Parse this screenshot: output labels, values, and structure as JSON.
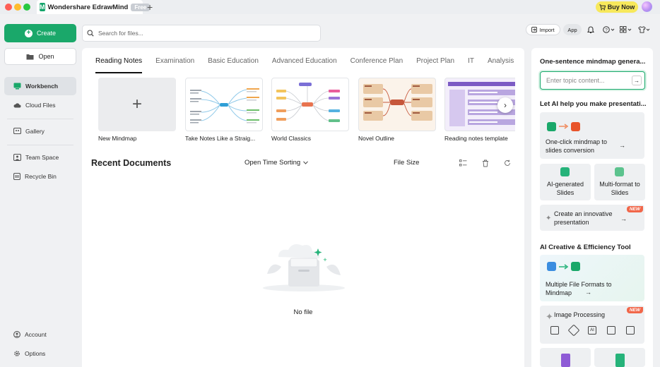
{
  "window": {
    "app_name": "Wondershare EdrawMind",
    "plan_badge": "Free",
    "new_tab": "+",
    "buy_now": "Buy Now"
  },
  "sidebar": {
    "create_label": "Create",
    "open_label": "Open",
    "items": [
      {
        "label": "Workbench",
        "icon": "workbench-icon",
        "active": true
      },
      {
        "label": "Cloud Files",
        "icon": "cloud-icon"
      },
      {
        "label": "Gallery",
        "icon": "gallery-icon"
      },
      {
        "label": "Team Space",
        "icon": "team-icon"
      },
      {
        "label": "Recycle Bin",
        "icon": "trash-icon"
      }
    ],
    "bottom": [
      {
        "label": "Account",
        "icon": "account-icon"
      },
      {
        "label": "Options",
        "icon": "gear-icon"
      }
    ]
  },
  "search": {
    "placeholder": "Search for files..."
  },
  "toolbar": {
    "import_label": "Import",
    "app_label": "App"
  },
  "tabs": [
    "Reading Notes",
    "Examination",
    "Basic Education",
    "Advanced Education",
    "Conference Plan",
    "Project Plan",
    "IT",
    "Analysis"
  ],
  "templates": [
    {
      "label": "New Mindmap"
    },
    {
      "label": "Take Notes Like a Straig..."
    },
    {
      "label": "World Classics"
    },
    {
      "label": "Novel Outline"
    },
    {
      "label": "Reading notes template"
    }
  ],
  "recent": {
    "title": "Recent Documents",
    "sort_label": "Open Time Sorting",
    "filesize_label": "File Size",
    "empty_label": "No file"
  },
  "right_panel": {
    "one_sentence_title": "One-sentence mindmap genera...",
    "topic_placeholder": "Enter topic content...",
    "ai_presentation_title": "Let AI help you make presentati...",
    "card_mindmap_to_slides": "One-click mindmap to slides conversion",
    "card_ai_slides": "AI-generated Slides",
    "card_multi_format_slides": "Multi-format to Slides",
    "card_innovative": "Create an innovative presentation",
    "new_badge": "NEW",
    "creative_title": "AI Creative & Efficiency Tool",
    "card_multi_file": "Multiple File Formats to Mindmap",
    "card_image_processing": "Image Processing",
    "ai_badge_text": "AI"
  },
  "colors": {
    "accent": "#1aa86a",
    "new_badge": "#f1674a",
    "buy_now": "#f7e85c"
  }
}
